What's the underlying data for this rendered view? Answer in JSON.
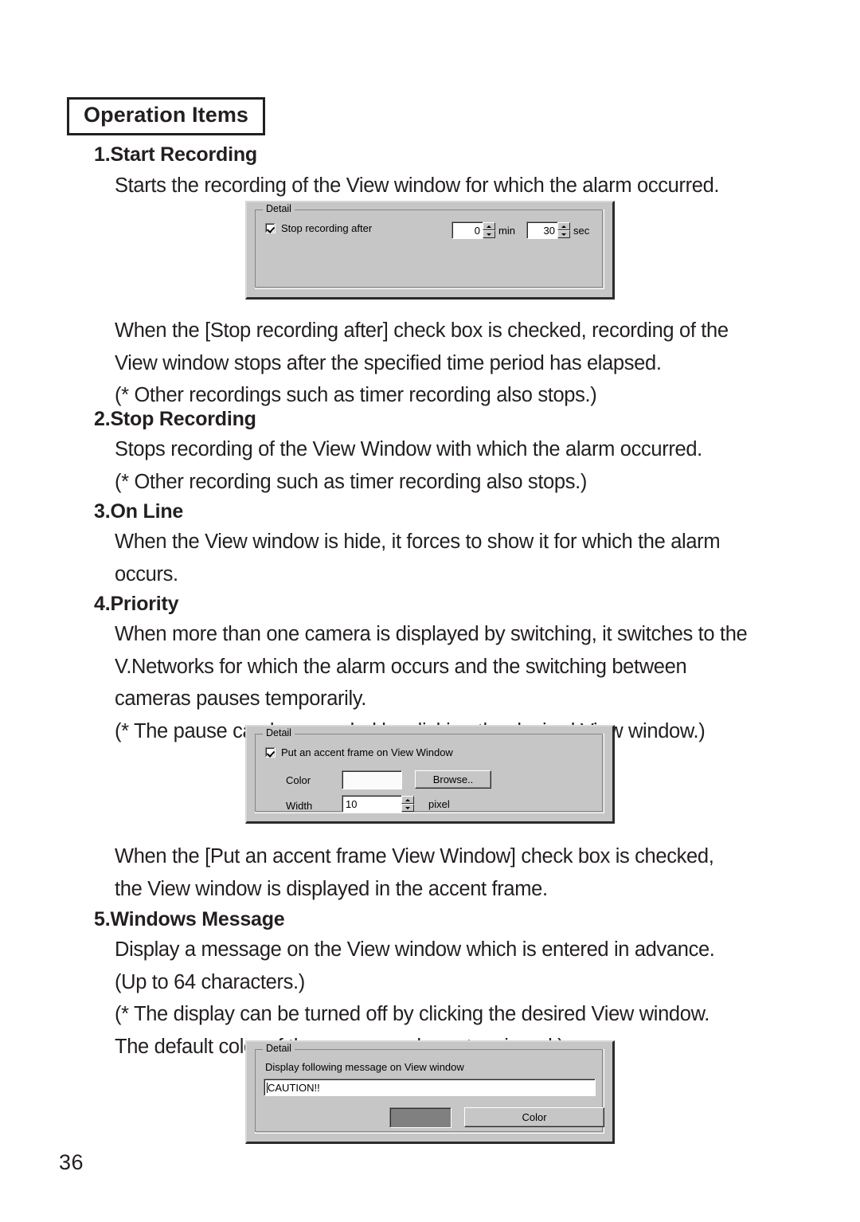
{
  "page": {
    "folio": "36"
  },
  "section": {
    "badge": "Operation Items"
  },
  "items": [
    {
      "heading": "1.Start Recording",
      "intro": "Starts the recording of the View window for which the alarm occurred.",
      "body": "When the [Stop recording after] check box is checked, recording of the\nView window stops after the specified time period has elapsed.\n(* Other recordings such as timer recording also stops.)"
    },
    {
      "heading": "2.Stop Recording",
      "body": "Stops recording of the View Window with which the alarm occurred.\n(* Other recording such as timer recording also stops.)"
    },
    {
      "heading": "3.On Line",
      "body": "When the View window is hide, it forces to show it for which the alarm\noccurs."
    },
    {
      "heading": "4.Priority",
      "intro": "When more than one camera is displayed by switching, it switches to the\nV.Networks for which the alarm occurs and the switching between\ncameras pauses temporarily.\n(* The pause can be canceled by clicking the desired View window.)",
      "body": "When the [Put an accent frame View Window] check box is checked,\nthe View window is displayed in the accent frame."
    },
    {
      "heading": "5.Windows Message",
      "body": "Display a message on the View window which is entered in advance.\n(Up to 64 characters.)\n(* The display can be turned off by clicking the desired View window.\nThe default color of the message characters is red.)"
    }
  ],
  "dialogs": {
    "stop_recording": {
      "legend": "Detail",
      "checkbox_label": "Stop recording after",
      "checkbox_checked": true,
      "minutes_value": "0",
      "minutes_unit": "min",
      "seconds_value": "30",
      "seconds_unit": "sec"
    },
    "accent_frame": {
      "legend": "Detail",
      "checkbox_label": "Put an accent frame on View Window",
      "checkbox_checked": true,
      "color_label": "Color",
      "color_swatch": "#fbfbfb",
      "browse_button": "Browse..",
      "width_label": "Width",
      "width_value": "10",
      "width_unit": "pixel"
    },
    "windows_message": {
      "legend": "Detail",
      "prompt": "Display following message on View window",
      "message_value": "CAUTION!!",
      "color_swatch": "#808080",
      "color_button": "Color"
    }
  }
}
